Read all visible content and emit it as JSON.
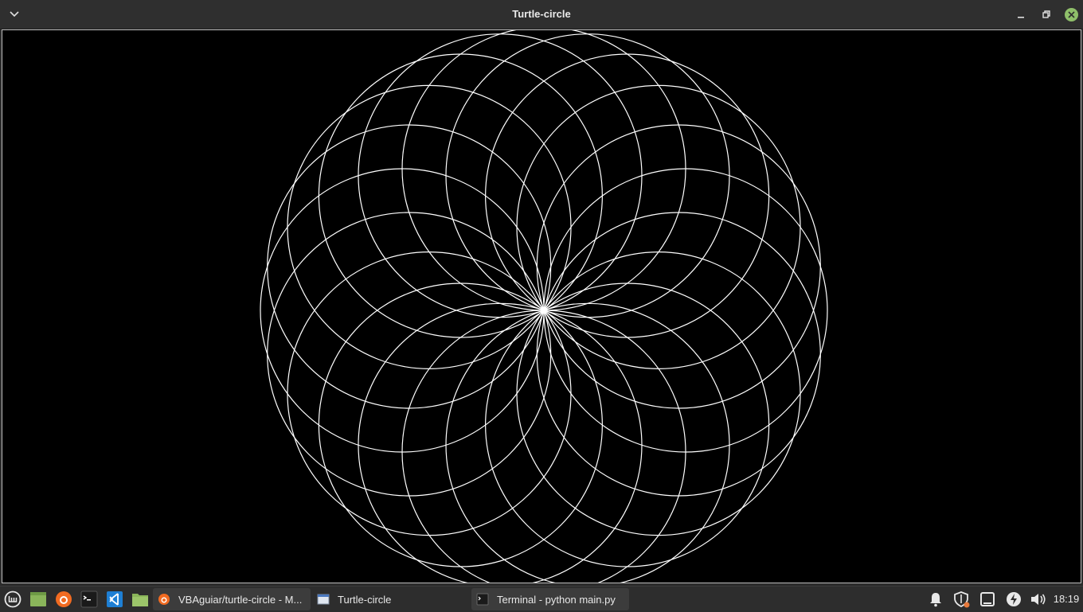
{
  "window": {
    "title": "Turtle-circle",
    "menu_icon": "chevron-down-icon",
    "controls": [
      "minimize-icon",
      "restore-icon",
      "close-icon"
    ],
    "close_color": "#8fbf6a"
  },
  "canvas": {
    "background": "#000000",
    "stroke": "#ffffff",
    "drawing": "spirograph of 20 overlapping circles rotated around a common point"
  },
  "taskbar": {
    "launchers": [
      "mint-menu-icon",
      "show-desktop-icon",
      "firefox-icon",
      "terminal-icon",
      "vscode-icon",
      "files-icon"
    ],
    "tasks": [
      {
        "label": "VBAguiar/turtle-circle - M...",
        "icon": "firefox-icon"
      },
      {
        "label": "Turtle-circle",
        "icon": "window-icon"
      },
      {
        "label": "Terminal - python main.py",
        "icon": "terminal-icon"
      }
    ],
    "tray": [
      "notifications-icon",
      "update-manager-icon",
      "removable-drive-icon",
      "power-icon",
      "volume-icon"
    ],
    "clock": "18:19",
    "update_badge_color": "#e8793b"
  }
}
